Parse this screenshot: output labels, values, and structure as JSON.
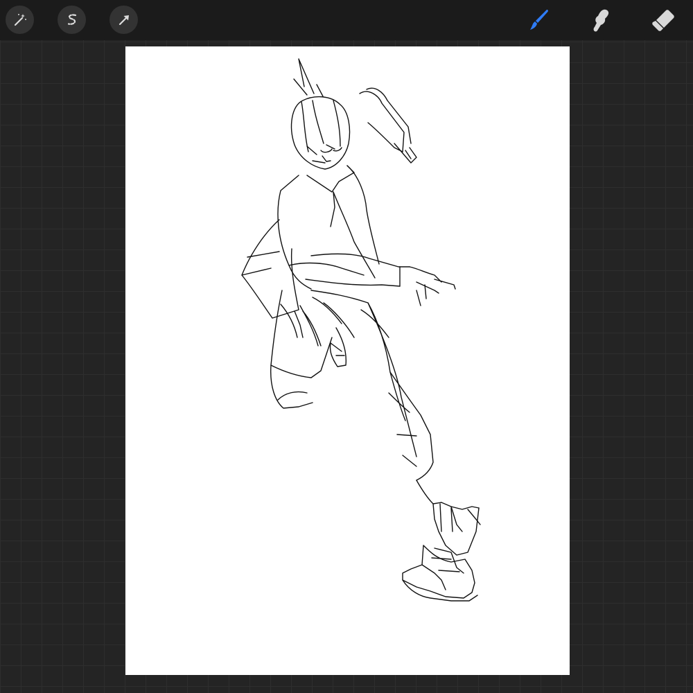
{
  "toolbar": {
    "left_tools": [
      {
        "name": "adjustments",
        "icon": "magic-wand-icon"
      },
      {
        "name": "selection",
        "icon": "selection-s-icon"
      },
      {
        "name": "transform",
        "icon": "arrow-cursor-icon"
      }
    ],
    "right_tools": [
      {
        "name": "brush",
        "icon": "brush-icon",
        "active": true
      },
      {
        "name": "smudge",
        "icon": "smudge-finger-icon",
        "active": false
      },
      {
        "name": "eraser",
        "icon": "eraser-icon",
        "active": false
      }
    ]
  },
  "colors": {
    "background": "#242424",
    "toolbar": "#1b1b1b",
    "grid_line": "#2e2e2e",
    "canvas": "#ffffff",
    "active_tool": "#2f7cf6",
    "inactive_tool": "#d8d8d8",
    "ink": "#111111"
  },
  "canvas": {
    "content": "line-art-sketch-running-figure"
  }
}
